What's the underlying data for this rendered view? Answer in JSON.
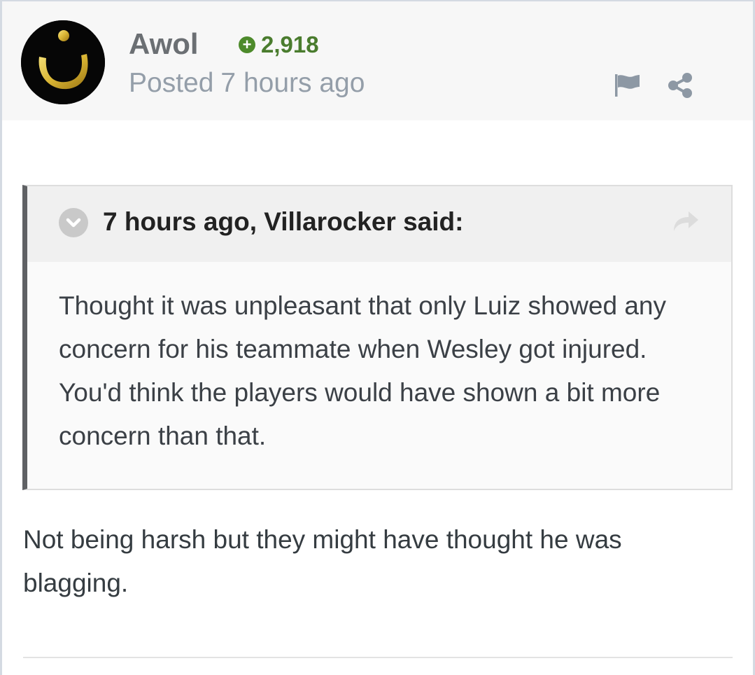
{
  "post": {
    "author": "Awol",
    "reputation": "2,918",
    "posted_prefix": "Posted",
    "posted_time": "7 hours ago"
  },
  "quote": {
    "citation": "7 hours ago, Villarocker said:",
    "lines": [
      "Thought it was unpleasant that only Luiz showed any",
      "concern for his teammate when Wesley got injured.",
      "You'd think the players would have shown a bit more",
      "concern than that."
    ]
  },
  "reply": {
    "lines": [
      "Not being harsh but they might have thought he was",
      "blagging."
    ]
  },
  "icons": {
    "avatar": "nun-symbol-avatar",
    "reputation": "plus-circle-icon",
    "report": "flag-icon",
    "share": "share-icon",
    "quote_toggle": "chevron-down-icon",
    "quote_link": "share-arrow-icon"
  },
  "colors": {
    "header_bg": "#f7f7f7",
    "reputation_green": "#4a7c2e",
    "meta_gray": "#949ea9",
    "quote_border": "#5f6164",
    "text": "#353c41"
  }
}
